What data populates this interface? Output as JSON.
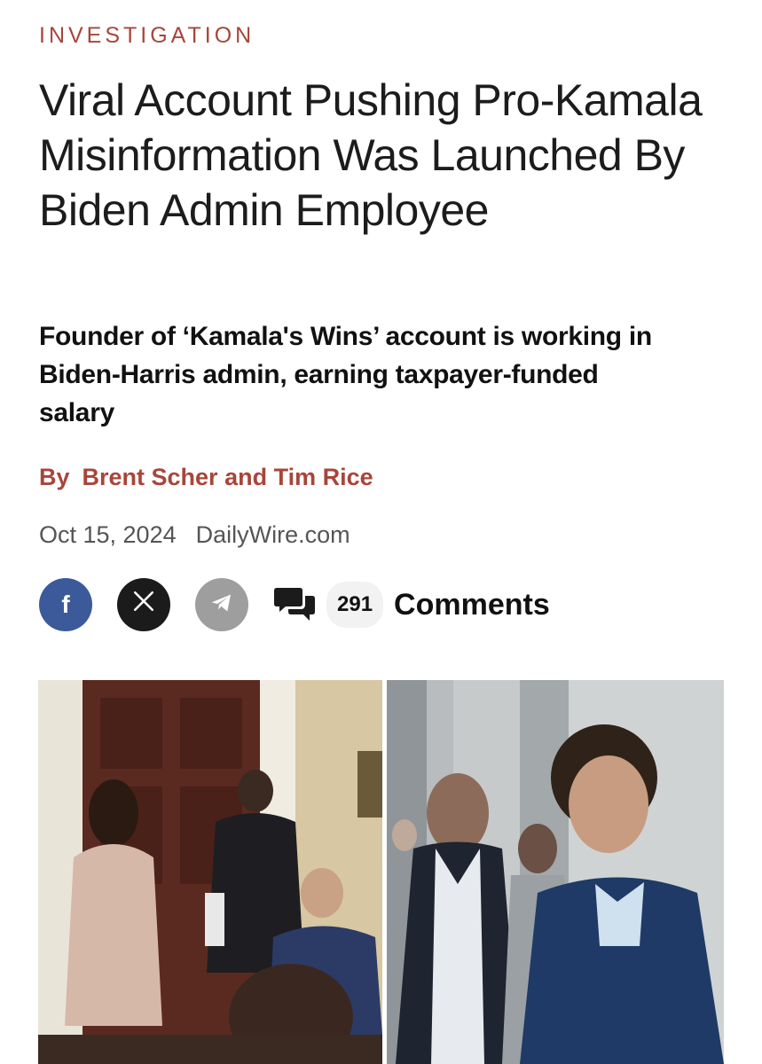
{
  "article": {
    "kicker": "INVESTIGATION",
    "headline": "Viral Account Pushing Pro-Kamala Misinformation Was Launched By Biden Admin Employee",
    "subheadline": "Founder of ‘Kamala's Wins’ account is working in Biden-Harris admin, earning taxpayer-funded salary",
    "byline_prefix": "By",
    "authors": "Brent Scher and Tim Rice",
    "date": "Oct 15, 2024",
    "source": "DailyWire.com"
  },
  "share": {
    "facebook_glyph": "f",
    "x_glyph": "𝕏",
    "comment_count": "291",
    "comments_label": "Comments"
  },
  "icons": {
    "facebook": "facebook-icon",
    "x": "x-icon",
    "telegram": "telegram-icon",
    "comments": "comment-bubbles-icon"
  },
  "colors": {
    "accent": "#a8453a",
    "facebook": "#3c5a9a",
    "x": "#1b1b1b",
    "telegram": "#9e9e9e"
  }
}
